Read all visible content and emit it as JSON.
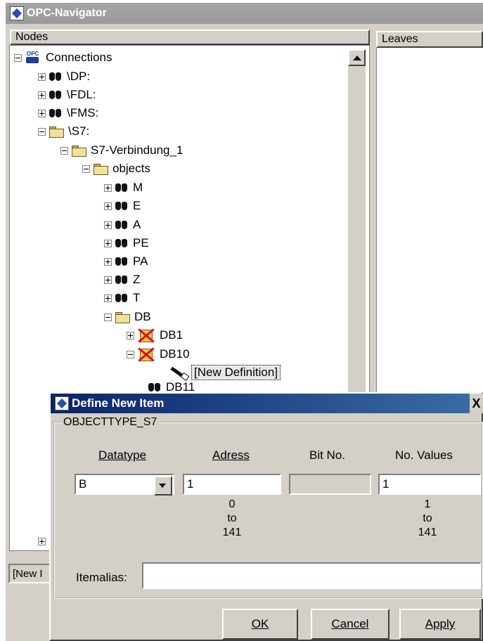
{
  "window": {
    "title": "OPC-Navigator"
  },
  "panes": {
    "nodes_header": "Nodes",
    "leaves_header": "Leaves",
    "status_left": "[New I"
  },
  "tree": {
    "root": "Connections",
    "dp": "\\DP:",
    "fdl": "\\FDL:",
    "fms": "\\FMS:",
    "s7": "\\S7:",
    "connection": "S7-Verbindung_1",
    "objects": "objects",
    "m": "M",
    "e": "E",
    "a": "A",
    "pe": "PE",
    "pa": "PA",
    "z": "Z",
    "t": "T",
    "db": "DB",
    "db1": "DB1",
    "db10": "DB10",
    "new_definition": "[New Definition]",
    "db11": "DB11"
  },
  "dialog": {
    "title": "Define New Item",
    "close": "X",
    "group_label": "OBJECTTYPE_S7",
    "datatype_label": "Datatype",
    "address_label": "Adress",
    "bitno_label": "Bit No.",
    "novalues_label": "No. Values",
    "datatype_value": "B",
    "address_value": "1",
    "bitno_value": "",
    "novalues_value": "1",
    "address_range": {
      "min": "0",
      "to": "to",
      "max": "141"
    },
    "novalues_range": {
      "min": "1",
      "to": "to",
      "max": "141"
    },
    "itemalias_label": "Itemalias:",
    "itemalias_value": "",
    "buttons": {
      "ok": "OK",
      "cancel": "Cancel",
      "apply": "Apply"
    }
  }
}
